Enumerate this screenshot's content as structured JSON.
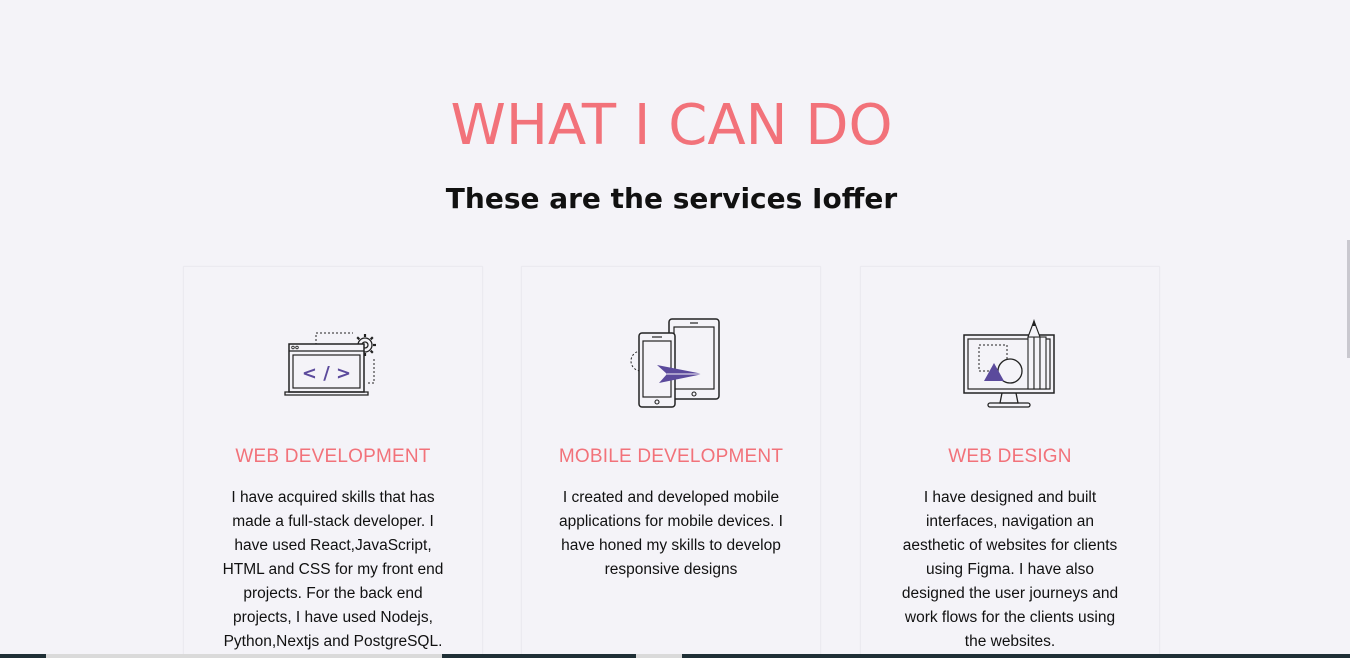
{
  "section": {
    "heading": "WHAT I CAN DO",
    "subheading": "These are the services Ioffer"
  },
  "services": [
    {
      "icon": "code-window-icon",
      "title": "WEB DEVELOPMENT",
      "description": "I have acquired skills that has made a full-stack developer. I have used React,JavaScript, HTML and CSS for my front end projects. For the back end projects, I have used Nodejs, Python,Nextjs and PostgreSQL."
    },
    {
      "icon": "mobile-devices-icon",
      "title": "MOBILE DEVELOPMENT",
      "description": "I created and developed mobile applications for mobile devices. I have honed my skills to develop responsive designs"
    },
    {
      "icon": "design-monitor-icon",
      "title": "WEB DESIGN",
      "description": "I have designed and built interfaces, navigation an aesthetic of websites for clients using Figma. I have also designed the user journeys and work flows for the clients using the websites."
    }
  ],
  "colors": {
    "accent": "#f2727a",
    "icon_accent": "#5b4a9c",
    "background": "#f4f3f8",
    "text": "#111111"
  }
}
